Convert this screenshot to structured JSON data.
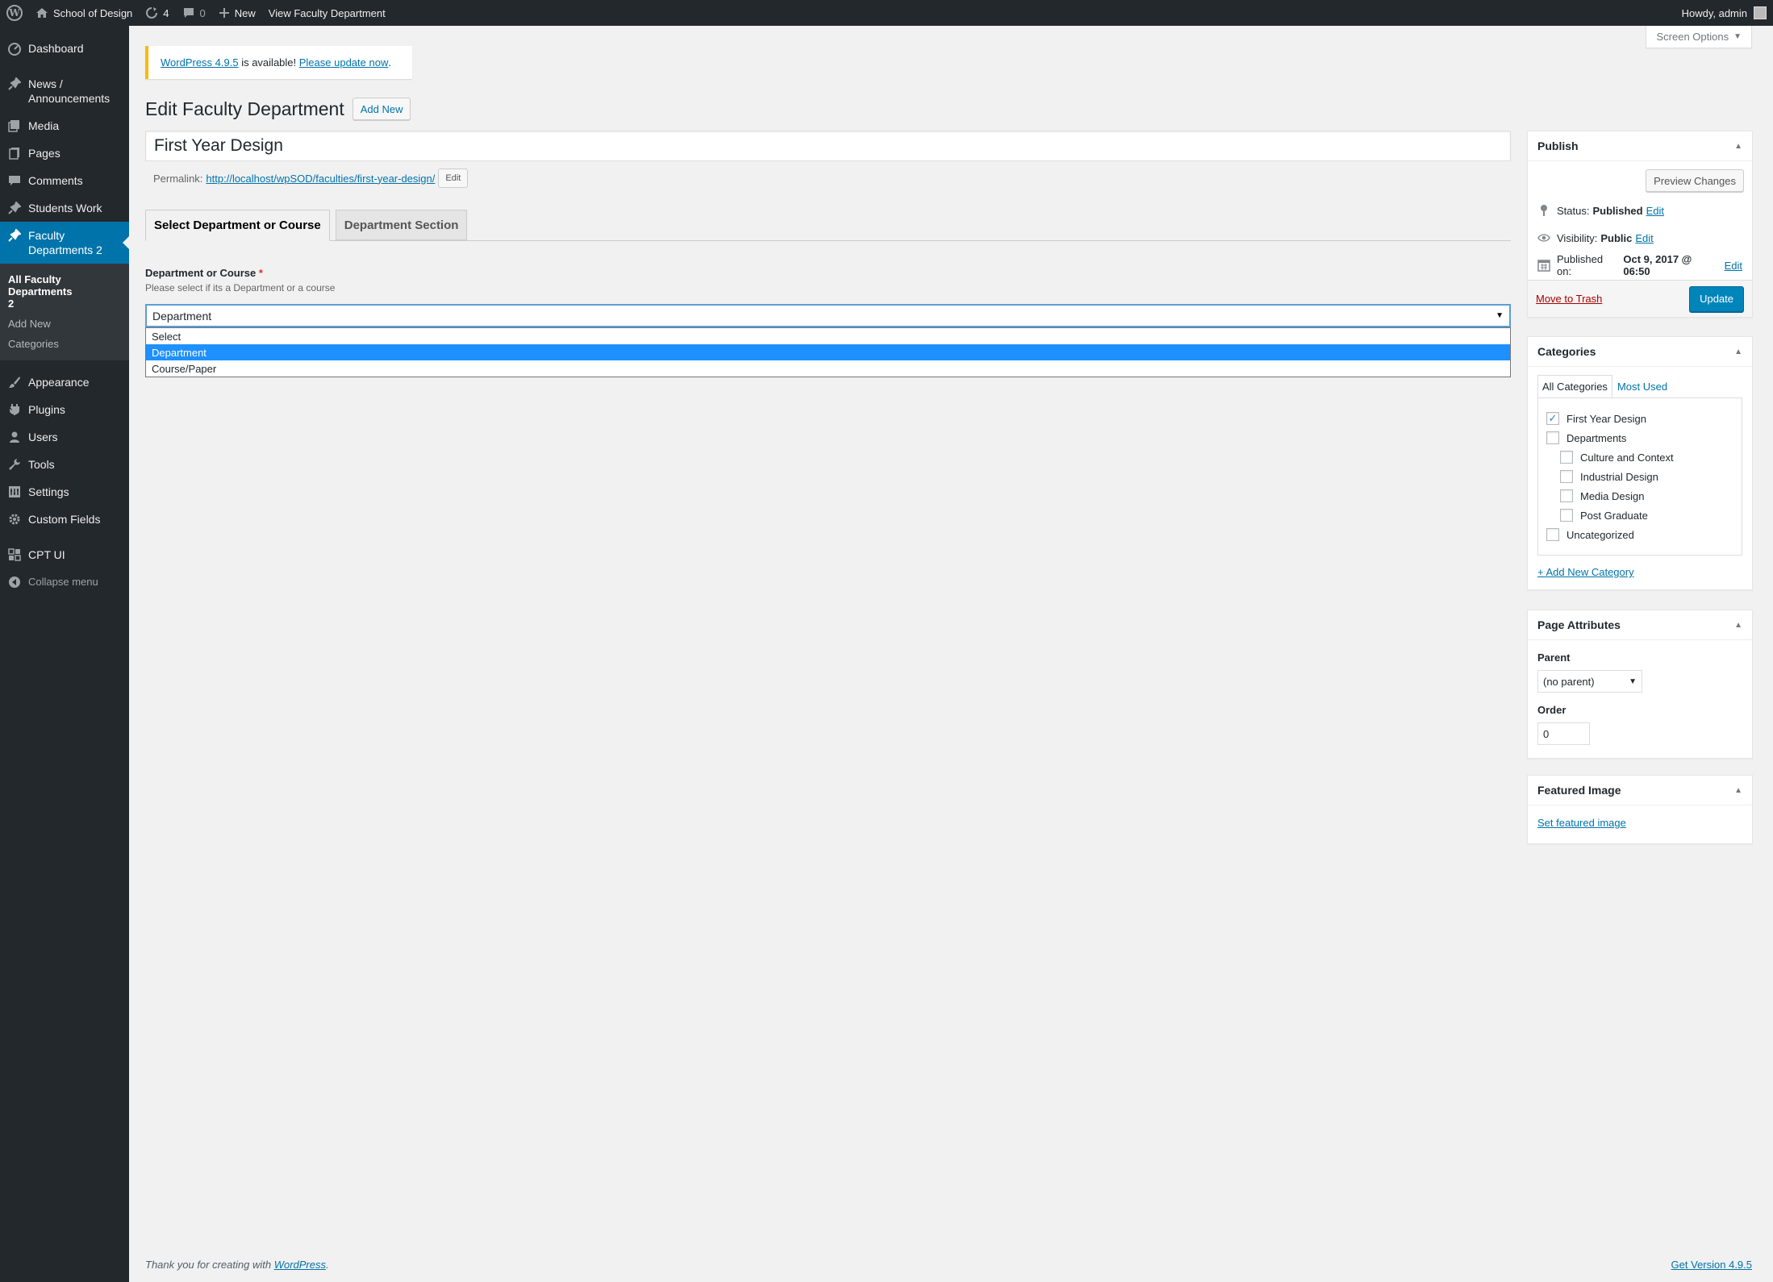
{
  "adminbar": {
    "site_name": "School of Design",
    "updates_count": "4",
    "comments_count": "0",
    "new_label": "New",
    "view_label": "View Faculty Department",
    "howdy": "Howdy, admin"
  },
  "sidebar": {
    "items": [
      {
        "label": "Dashboard",
        "icon": "dashboard-icon"
      },
      {
        "label": "News / Announcements",
        "icon": "pin-icon"
      },
      {
        "label": "Media",
        "icon": "media-icon"
      },
      {
        "label": "Pages",
        "icon": "page-icon"
      },
      {
        "label": "Comments",
        "icon": "comment-icon"
      },
      {
        "label": "Students Work",
        "icon": "pin-icon"
      },
      {
        "label": "Faculty Departments 2",
        "icon": "pin-icon"
      },
      {
        "label": "Appearance",
        "icon": "brush-icon"
      },
      {
        "label": "Plugins",
        "icon": "plugin-icon"
      },
      {
        "label": "Users",
        "icon": "user-icon"
      },
      {
        "label": "Tools",
        "icon": "wrench-icon"
      },
      {
        "label": "Settings",
        "icon": "settings-icon"
      },
      {
        "label": "Custom Fields",
        "icon": "gear-icon"
      },
      {
        "label": "CPT UI",
        "icon": "grid-icon"
      }
    ],
    "submenu": [
      "All Faculty Departments 2",
      "Add New",
      "Categories"
    ],
    "collapse_label": "Collapse menu"
  },
  "header": {
    "screen_options": "Screen Options",
    "notice_link1": "WordPress 4.9.5",
    "notice_text": " is available! ",
    "notice_link2": "Please update now",
    "notice_end": ".",
    "title": "Edit Faculty Department",
    "add_new": "Add New"
  },
  "editor": {
    "post_title": "First Year Design",
    "permalink_label": "Permalink:",
    "permalink_url": "http://localhost/wpSOD/faculties/first-year-design/",
    "permalink_edit": "Edit"
  },
  "tabs": [
    "Select Department or Course",
    "Department Section"
  ],
  "field": {
    "label": "Department or Course",
    "required": "*",
    "description": "Please select if its a Department or a course",
    "selected": "Department",
    "options": [
      "Select",
      "Department",
      "Course/Paper"
    ]
  },
  "publish": {
    "title": "Publish",
    "preview": "Preview Changes",
    "status_label": "Status:",
    "status_value": "Published",
    "visibility_label": "Visibility:",
    "visibility_value": "Public",
    "published_label": "Published on:",
    "published_value": "Oct 9, 2017 @ 06:50",
    "edit": "Edit",
    "trash": "Move to Trash",
    "update": "Update"
  },
  "categories": {
    "title": "Categories",
    "tab_all": "All Categories",
    "tab_most": "Most Used",
    "items": [
      {
        "label": "First Year Design",
        "checked": true,
        "child": false
      },
      {
        "label": "Departments",
        "checked": false,
        "child": false
      },
      {
        "label": "Culture and Context",
        "checked": false,
        "child": true
      },
      {
        "label": "Industrial Design",
        "checked": false,
        "child": true
      },
      {
        "label": "Media Design",
        "checked": false,
        "child": true
      },
      {
        "label": "Post Graduate",
        "checked": false,
        "child": true
      },
      {
        "label": "Uncategorized",
        "checked": false,
        "child": false
      }
    ],
    "add_new": "+ Add New Category"
  },
  "page_attributes": {
    "title": "Page Attributes",
    "parent_label": "Parent",
    "parent_value": "(no parent)",
    "order_label": "Order",
    "order_value": "0"
  },
  "featured_image": {
    "title": "Featured Image",
    "link": "Set featured image"
  },
  "footer": {
    "thanks_prefix": "Thank you for creating with ",
    "thanks_link": "WordPress",
    "thanks_suffix": ".",
    "version": "Get Version 4.9.5"
  },
  "colors": {
    "adminbar_bg": "#23282d",
    "accent": "#0073aa",
    "primary_button": "#0085ba",
    "selected_option": "#1e90ff",
    "notice_border": "#ffb900"
  }
}
